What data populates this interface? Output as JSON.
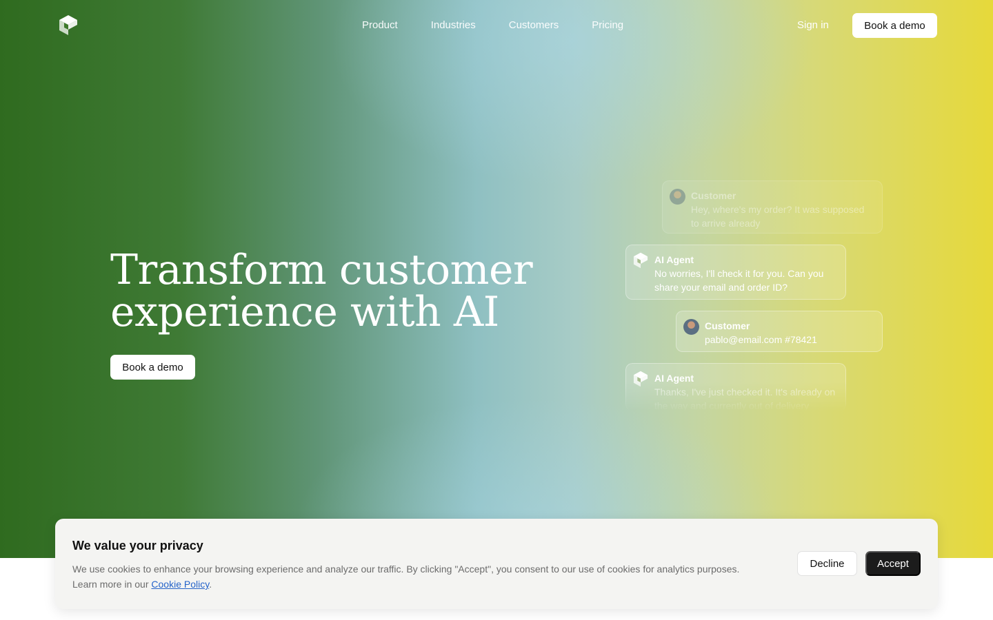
{
  "header": {
    "logo_icon": "cube-logo-icon",
    "nav": [
      "Product",
      "Industries",
      "Customers",
      "Pricing"
    ],
    "sign_in": "Sign in",
    "cta": "Book a demo"
  },
  "hero": {
    "headline_line1": "Transform customer",
    "headline_line2": "experience with AI",
    "cta": "Book a demo"
  },
  "chat": [
    {
      "role": "Customer",
      "message": "Hey, where's my order? It was supposed to arrive already",
      "icon": "avatar"
    },
    {
      "role": "AI Agent",
      "message": "No worries, I'll check it for you. Can you share your email and order ID?",
      "icon": "cube-logo-icon"
    },
    {
      "role": "Customer",
      "message": "pablo@email.com #78421",
      "icon": "avatar"
    },
    {
      "role": "AI Agent",
      "message": "Thanks, I've just checked it. It's already on the way and currently out of delivery",
      "icon": "cube-logo-icon"
    }
  ],
  "cookie": {
    "title": "We value your privacy",
    "text": "We use cookies to enhance your browsing experience and analyze our traffic. By clicking \"Accept\", you consent to our use of cookies for analytics purposes. Learn more in our ",
    "link": "Cookie Policy",
    "text_end": ".",
    "decline": "Decline",
    "accept": "Accept"
  }
}
